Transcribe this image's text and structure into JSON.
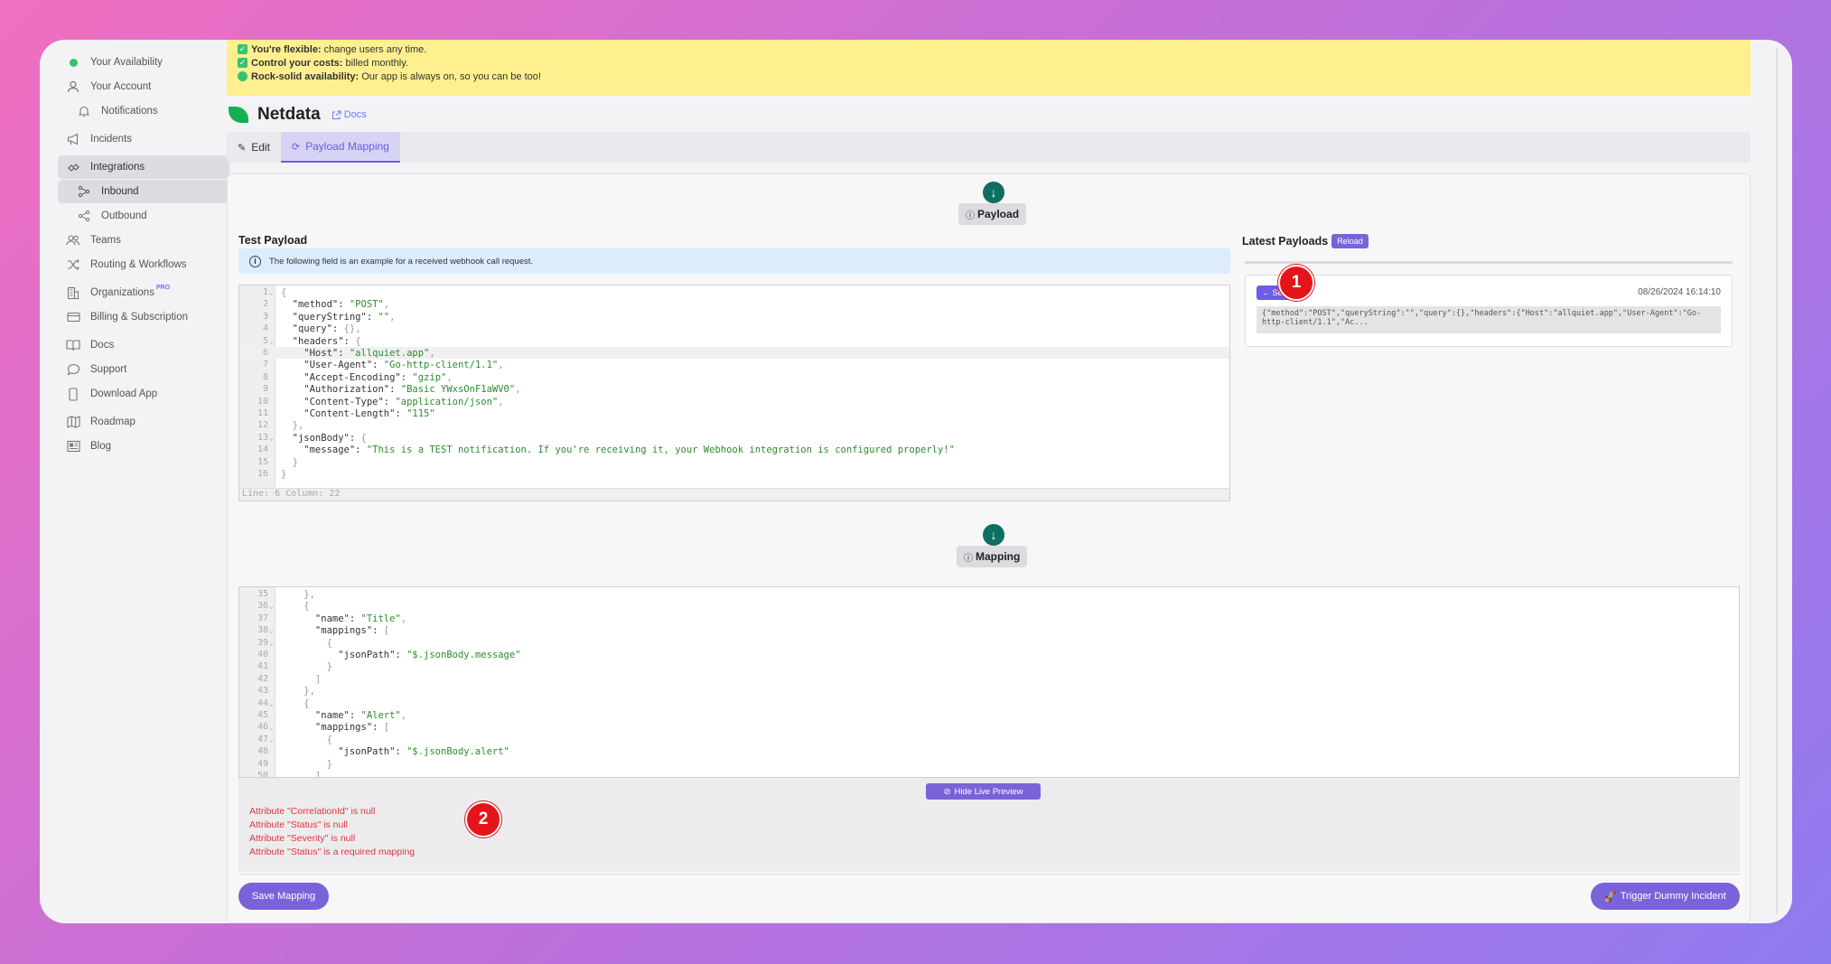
{
  "sidebar": {
    "items": [
      {
        "label": "Your Availability",
        "icon": "status-dot-icon"
      },
      {
        "label": "Your Account",
        "icon": "user-icon"
      },
      {
        "label": "Notifications",
        "icon": "bell-icon"
      },
      {
        "label": "Incidents",
        "icon": "megaphone-icon"
      },
      {
        "label": "Integrations",
        "icon": "integrations-icon"
      },
      {
        "label": "Inbound",
        "icon": "inbound-icon"
      },
      {
        "label": "Outbound",
        "icon": "share-icon"
      },
      {
        "label": "Teams",
        "icon": "users-icon"
      },
      {
        "label": "Routing & Workflows",
        "icon": "shuffle-icon"
      },
      {
        "label": "Organizations",
        "icon": "building-icon",
        "badge": "PRO"
      },
      {
        "label": "Billing & Subscription",
        "icon": "credit-card-icon"
      },
      {
        "label": "Docs",
        "icon": "book-icon"
      },
      {
        "label": "Support",
        "icon": "chat-icon"
      },
      {
        "label": "Download App",
        "icon": "phone-icon"
      },
      {
        "label": "Roadmap",
        "icon": "map-icon"
      },
      {
        "label": "Blog",
        "icon": "newspaper-icon"
      }
    ]
  },
  "banner": {
    "lines": [
      {
        "bold": "You're flexible:",
        "text": "change users any time."
      },
      {
        "bold": "Control your costs:",
        "text": "billed monthly."
      },
      {
        "bold": "Rock-solid availability:",
        "text": "Our app is always on, so you can be too!"
      }
    ]
  },
  "page": {
    "title": "Netdata",
    "docs_link": "Docs",
    "tabs": [
      {
        "label": "Edit"
      },
      {
        "label": "Payload Mapping"
      }
    ]
  },
  "payload": {
    "step_label": "Payload",
    "test_title": "Test Payload",
    "info_text": "The following field is an example for a received webhook call request.",
    "status": "Line: 6  Column: 22",
    "code": [
      {
        "n": "1",
        "f": true,
        "segs": [
          [
            "p",
            "{"
          ]
        ]
      },
      {
        "n": "2",
        "segs": [
          [
            "k",
            "  \"method\": "
          ],
          [
            "s",
            "\"POST\""
          ],
          [
            "p",
            ","
          ]
        ]
      },
      {
        "n": "3",
        "segs": [
          [
            "k",
            "  \"queryString\": "
          ],
          [
            "s",
            "\"\""
          ],
          [
            "p",
            ","
          ]
        ]
      },
      {
        "n": "4",
        "segs": [
          [
            "k",
            "  \"query\": "
          ],
          [
            "p",
            "{},"
          ]
        ]
      },
      {
        "n": "5",
        "f": true,
        "segs": [
          [
            "k",
            "  \"headers\": "
          ],
          [
            "p",
            "{"
          ]
        ]
      },
      {
        "n": "6",
        "segs": [
          [
            "k",
            "    \"Host\": "
          ],
          [
            "s",
            "\"allquiet.app\""
          ],
          [
            "p",
            ","
          ]
        ]
      },
      {
        "n": "7",
        "segs": [
          [
            "k",
            "    \"User-Agent\": "
          ],
          [
            "s",
            "\"Go-http-client/1.1\""
          ],
          [
            "p",
            ","
          ]
        ]
      },
      {
        "n": "8",
        "segs": [
          [
            "k",
            "    \"Accept-Encoding\": "
          ],
          [
            "s",
            "\"gzip\""
          ],
          [
            "p",
            ","
          ]
        ]
      },
      {
        "n": "9",
        "segs": [
          [
            "k",
            "    \"Authorization\": "
          ],
          [
            "s",
            "\"Basic YWxsOnF1aWV0\""
          ],
          [
            "p",
            ","
          ]
        ]
      },
      {
        "n": "10",
        "segs": [
          [
            "k",
            "    \"Content-Type\": "
          ],
          [
            "s",
            "\"application/json\""
          ],
          [
            "p",
            ","
          ]
        ]
      },
      {
        "n": "11",
        "segs": [
          [
            "k",
            "    \"Content-Length\": "
          ],
          [
            "s",
            "\"115\""
          ]
        ]
      },
      {
        "n": "12",
        "segs": [
          [
            "p",
            "  },"
          ]
        ]
      },
      {
        "n": "13",
        "f": true,
        "segs": [
          [
            "k",
            "  \"jsonBody\": "
          ],
          [
            "p",
            "{"
          ]
        ]
      },
      {
        "n": "14",
        "segs": [
          [
            "k",
            "    \"message\": "
          ],
          [
            "s",
            "\"This is a TEST notification. If you're receiving it, your Webhook integration is configured properly!\""
          ]
        ]
      },
      {
        "n": "15",
        "segs": [
          [
            "p",
            "  }"
          ]
        ]
      },
      {
        "n": "16",
        "segs": [
          [
            "p",
            "}"
          ]
        ]
      }
    ]
  },
  "latest": {
    "title": "Latest Payloads",
    "reload": "Reload",
    "select": "← Select",
    "date": "08/26/2024 16:14:10",
    "json_preview": "{\"method\":\"POST\",\"queryString\":\"\",\"query\":{},\"headers\":{\"Host\":\"allquiet.app\",\"User-Agent\":\"Go-http-client/1.1\",\"Ac..."
  },
  "mapping": {
    "step_label": "Mapping",
    "code": [
      {
        "n": "35",
        "segs": [
          [
            "p",
            "    },"
          ]
        ]
      },
      {
        "n": "36",
        "f": true,
        "segs": [
          [
            "p",
            "    {"
          ]
        ]
      },
      {
        "n": "37",
        "segs": [
          [
            "k",
            "      \"name\": "
          ],
          [
            "s",
            "\"Title\""
          ],
          [
            "p",
            ","
          ]
        ]
      },
      {
        "n": "38",
        "f": true,
        "segs": [
          [
            "k",
            "      \"mappings\": "
          ],
          [
            "p",
            "["
          ]
        ]
      },
      {
        "n": "39",
        "f": true,
        "segs": [
          [
            "p",
            "        {"
          ]
        ]
      },
      {
        "n": "40",
        "segs": [
          [
            "k",
            "          \"jsonPath\": "
          ],
          [
            "s",
            "\"$.jsonBody.message\""
          ]
        ]
      },
      {
        "n": "41",
        "segs": [
          [
            "p",
            "        }"
          ]
        ]
      },
      {
        "n": "42",
        "segs": [
          [
            "p",
            "      ]"
          ]
        ]
      },
      {
        "n": "43",
        "segs": [
          [
            "p",
            "    },"
          ]
        ]
      },
      {
        "n": "44",
        "f": true,
        "segs": [
          [
            "p",
            "    {"
          ]
        ]
      },
      {
        "n": "45",
        "segs": [
          [
            "k",
            "      \"name\": "
          ],
          [
            "s",
            "\"Alert\""
          ],
          [
            "p",
            ","
          ]
        ]
      },
      {
        "n": "46",
        "f": true,
        "segs": [
          [
            "k",
            "      \"mappings\": "
          ],
          [
            "p",
            "["
          ]
        ]
      },
      {
        "n": "47",
        "f": true,
        "segs": [
          [
            "p",
            "        {"
          ]
        ]
      },
      {
        "n": "48",
        "segs": [
          [
            "k",
            "          \"jsonPath\": "
          ],
          [
            "s",
            "\"$.jsonBody.alert\""
          ]
        ]
      },
      {
        "n": "49",
        "segs": [
          [
            "p",
            "        }"
          ]
        ]
      },
      {
        "n": "50",
        "segs": [
          [
            "p",
            "      ]"
          ]
        ]
      }
    ],
    "hide_preview": "Hide Live Preview",
    "errors": [
      "Attribute \"CorrelationId\" is null",
      "Attribute \"Status\" is null",
      "Attribute \"Severity\" is null",
      "Attribute \"Status\" is a required mapping"
    ]
  },
  "footer": {
    "save": "Save Mapping",
    "trigger": "Trigger Dummy Incident"
  },
  "annotations": [
    "1",
    "2"
  ],
  "colors": {
    "accent": "#7a63d8",
    "error": "#e0363c",
    "badge": "#e4141b",
    "banner": "#fff08f",
    "step_circle": "#0f6e5f"
  }
}
